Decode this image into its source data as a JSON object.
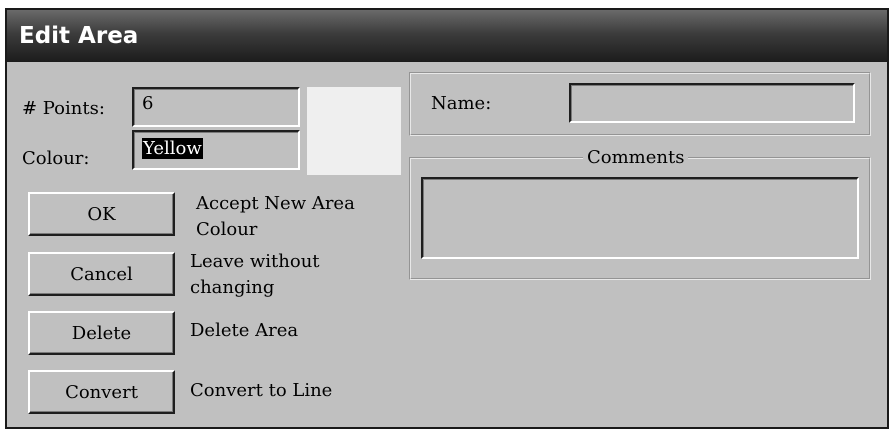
{
  "window": {
    "title": "Edit Area"
  },
  "points": {
    "label": "# Points:",
    "value": "6"
  },
  "colour": {
    "label": "Colour:",
    "value": "Yellow",
    "swatch": "#efefef"
  },
  "name": {
    "label": "Name:",
    "value": ""
  },
  "comments": {
    "label": "Comments",
    "value": ""
  },
  "buttons": [
    {
      "label": "OK",
      "desc_line1": "Accept New Area",
      "desc_line2": "Colour"
    },
    {
      "label": "Cancel",
      "desc_line1": "Leave without",
      "desc_line2": "changing"
    },
    {
      "label": "Delete",
      "desc_line1": "Delete Area",
      "desc_line2": ""
    },
    {
      "label": "Convert",
      "desc_line1": "Convert to Line",
      "desc_line2": ""
    }
  ]
}
